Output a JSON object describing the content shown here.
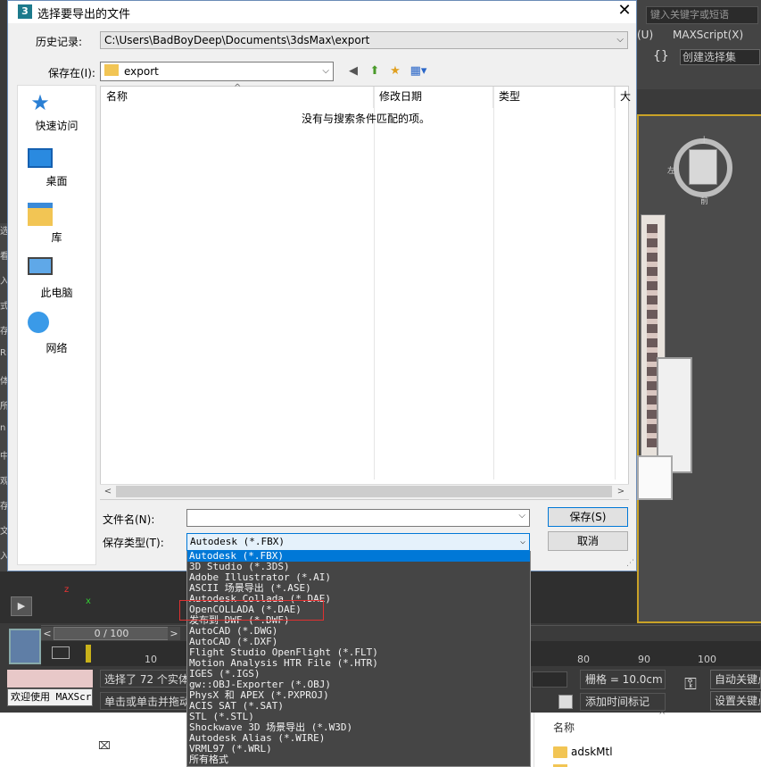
{
  "max": {
    "search_placeholder": "键入关键字或短语",
    "menu": [
      "(U)",
      "MAXScript(X)"
    ],
    "selection_set": "创建选择集",
    "viewcube_labels": [
      "上",
      "左",
      "前"
    ],
    "left_strip": [
      "选",
      "看",
      "入",
      "式",
      "存",
      "Ri",
      "体",
      "所",
      "n",
      "中",
      "观",
      "存",
      "文",
      "入",
      "存",
      "L"
    ],
    "timeslider": {
      "position": "0 / 100",
      "prev": "<",
      "next": ">"
    },
    "ticks": [
      "10",
      "80",
      "90",
      "100"
    ],
    "maxscript_text": "欢迎使用 MAXScr",
    "status_line1": "选择了 72 个实体",
    "status_line2": "单击或单击并拖动",
    "grid": "栅格 = 10.0cm",
    "add_time_tag": "添加时间标记",
    "auto_key": "自动关键点",
    "set_key": "设置关键点",
    "play_icon": "▶",
    "key_icon": "⚿"
  },
  "explorer": {
    "column_header": "名称",
    "folder": "adskMtl",
    "cmd_icon": "⌧"
  },
  "dialog": {
    "title": "选择要导出的文件",
    "history_label": "历史记录:",
    "history_path": "C:\\Users\\BadBoyDeep\\Documents\\3dsMax\\export",
    "save_in_label": "保存在(I):",
    "save_in_value": "export",
    "places": [
      {
        "label": "快速访问",
        "icon": "star-icon"
      },
      {
        "label": "桌面",
        "icon": "desktop-icon"
      },
      {
        "label": "库",
        "icon": "library-icon"
      },
      {
        "label": "此电脑",
        "icon": "computer-icon"
      },
      {
        "label": "网络",
        "icon": "network-icon"
      }
    ],
    "columns": [
      "名称",
      "修改日期",
      "类型",
      "大"
    ],
    "empty_message": "没有与搜索条件匹配的项。",
    "file_name_label": "文件名(N):",
    "file_name_value": "",
    "file_type_label": "保存类型(T):",
    "file_type_value": "Autodesk (*.FBX)",
    "save_button": "保存(S)",
    "cancel_button": "取消",
    "file_types": [
      "Autodesk (*.FBX)",
      "3D Studio (*.3DS)",
      "Adobe Illustrator (*.AI)",
      "ASCII 场景导出 (*.ASE)",
      "Autodesk Collada (*.DAE)",
      "OpenCOLLADA (*.DAE)",
      "发布到 DWF (*.DWF)",
      "AutoCAD (*.DWG)",
      "AutoCAD (*.DXF)",
      "Flight Studio OpenFlight (*.FLT)",
      "Motion Analysis HTR File (*.HTR)",
      "IGES (*.IGS)",
      "gw::OBJ-Exporter (*.OBJ)",
      "PhysX 和 APEX (*.PXPROJ)",
      "ACIS SAT (*.SAT)",
      "STL (*.STL)",
      "Shockwave 3D 场景导出 (*.W3D)",
      "Autodesk Alias (*.WIRE)",
      "VRML97 (*.WRL)",
      "所有格式"
    ]
  }
}
